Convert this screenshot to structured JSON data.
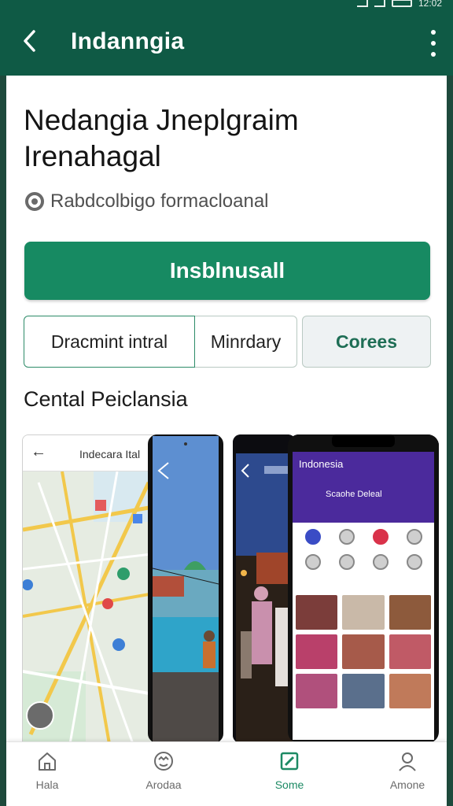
{
  "status_bar": {
    "time": "12:02"
  },
  "app_bar": {
    "title": "Indanngia",
    "back_icon": "back-arrow-icon",
    "more_icon": "more-vertical-icon"
  },
  "app": {
    "title": "Nedangia Jneplgraim Irenahagal",
    "developer": "Rabdcolbigo formacloanal",
    "developer_icon": "radio-icon"
  },
  "install_button": {
    "label": "Insblnusall"
  },
  "tabs": [
    {
      "label": "Dracmint intral"
    },
    {
      "label": "Minrdary"
    },
    {
      "label": "Corees"
    }
  ],
  "screenshots": {
    "title": "Cental Peiclansia",
    "map": {
      "title": "Indecara Ital"
    },
    "phone": {
      "header_title": "Indonesia",
      "subheader": "Scaohe Deleal"
    }
  },
  "bottom_nav": [
    {
      "label": "Hala",
      "icon": "home-icon"
    },
    {
      "label": "Arodaa",
      "icon": "face-icon"
    },
    {
      "label": "Some",
      "icon": "edit-square-icon",
      "active": true
    },
    {
      "label": "Amone",
      "icon": "person-icon"
    }
  ],
  "colors": {
    "primary": "#0f5a45",
    "install": "#178a62",
    "accent_tab": "#1e6e55",
    "phone_header": "#4b2a9c"
  }
}
